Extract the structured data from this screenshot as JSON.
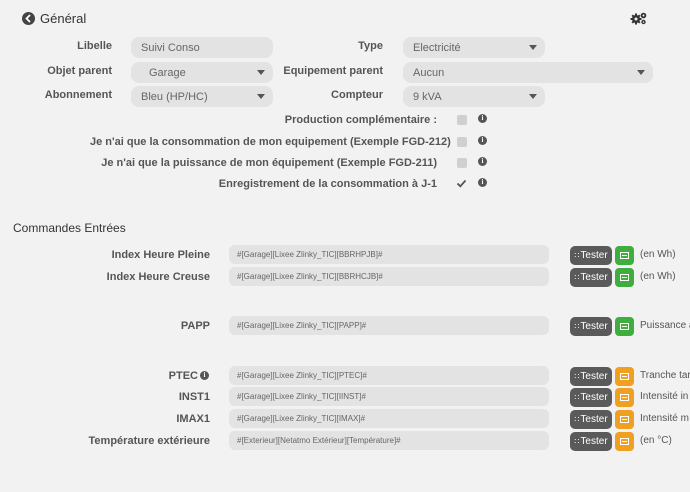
{
  "header": {
    "title": "Général",
    "back_icon": "back-arrow-icon",
    "settings_icon": "gears-icon"
  },
  "form": {
    "libelle": {
      "label": "Libelle",
      "value": "Suivi Conso"
    },
    "type": {
      "label": "Type",
      "value": "Electricité"
    },
    "objet_parent": {
      "label": "Objet parent",
      "value": "Garage"
    },
    "equipement_parent": {
      "label": "Equipement parent",
      "value": "Aucun"
    },
    "abonnement": {
      "label": "Abonnement",
      "value": "Bleu (HP/HC)"
    },
    "compteur": {
      "label": "Compteur",
      "value": "9 kVA"
    },
    "options": [
      {
        "label": "Production complémentaire :",
        "checked": false
      },
      {
        "label": "Je n'ai que la consommation de mon equipement (Exemple FGD-212)",
        "checked": false
      },
      {
        "label": "Je n'ai que la puissance de mon équipement (Exemple FGD-211)",
        "checked": false
      },
      {
        "label": "Enregistrement de la consommation à J-1",
        "checked": true
      }
    ]
  },
  "section": {
    "title": "Commandes Entrées"
  },
  "commands": [
    {
      "label": "Index Heure Pleine",
      "value": "#[Garage][Lixee Zlinky_TIC][BBRHPJB]#",
      "tester": "Tester",
      "hist_color": "green",
      "unit": "(en Wh)"
    },
    {
      "label": "Index Heure Creuse",
      "value": "#[Garage][Lixee Zlinky_TIC][BBRHCJB]#",
      "tester": "Tester",
      "hist_color": "green",
      "unit": "(en Wh)"
    },
    {
      "label": "PAPP",
      "value": "#[Garage][Lixee Zlinky_TIC][PAPP]#",
      "tester": "Tester",
      "hist_color": "green",
      "unit": "Puissance a"
    },
    {
      "label": "PTEC",
      "value": "#[Garage][Lixee Zlinky_TIC][PTEC]#",
      "tester": "Tester",
      "hist_color": "orange",
      "unit": "Tranche tar"
    },
    {
      "label": "INST1",
      "value": "#[Garage][Lixee Zlinky_TIC][IINST]#",
      "tester": "Tester",
      "hist_color": "orange",
      "unit": "Intensité in"
    },
    {
      "label": "IMAX1",
      "value": "#[Garage][Lixee Zlinky_TIC][IMAX]#",
      "tester": "Tester",
      "hist_color": "orange",
      "unit": "Intensité m"
    },
    {
      "label": "Température extérieure",
      "value": "#[Exterieur][Netatmo Extérieur][Température]#",
      "tester": "Tester",
      "hist_color": "orange",
      "unit": "(en °C)"
    }
  ]
}
